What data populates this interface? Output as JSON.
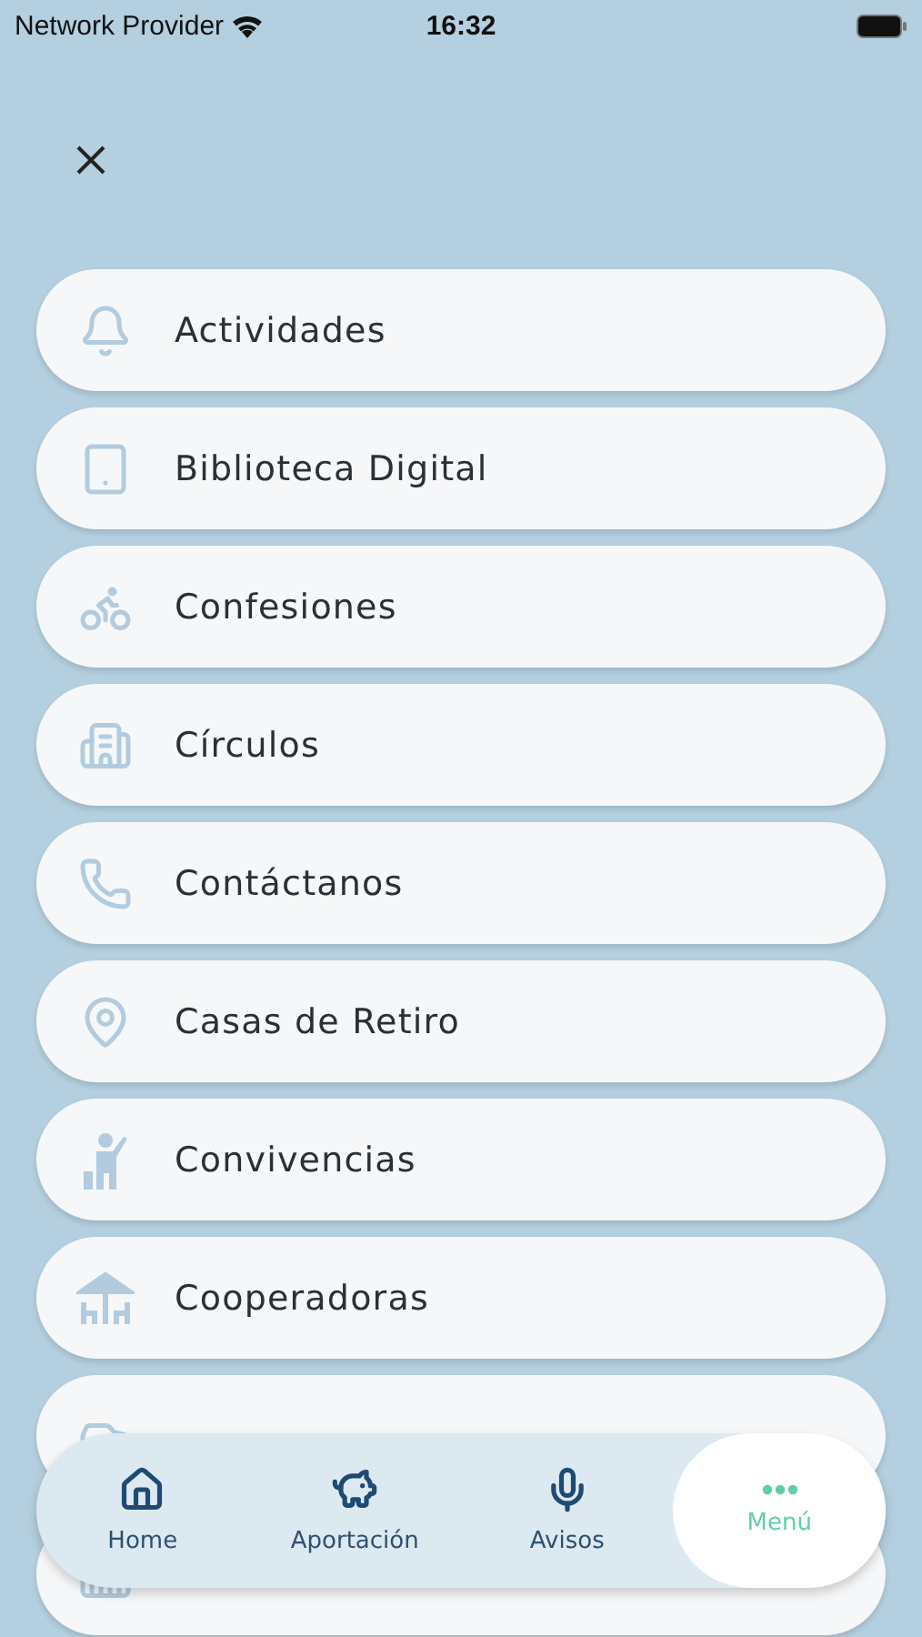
{
  "status_bar": {
    "carrier": "Network Provider",
    "time": "16:32"
  },
  "menu_items": [
    {
      "label": "Actividades"
    },
    {
      "label": "Biblioteca Digital"
    },
    {
      "label": "Confesiones"
    },
    {
      "label": "Círculos"
    },
    {
      "label": "Contáctanos"
    },
    {
      "label": "Casas de Retiro"
    },
    {
      "label": "Convivencias"
    },
    {
      "label": "Cooperadoras"
    }
  ],
  "tab_bar": [
    {
      "label": "Home",
      "selected": false
    },
    {
      "label": "Aportación",
      "selected": false
    },
    {
      "label": "Avisos",
      "selected": false
    },
    {
      "label": "Menú",
      "selected": true
    }
  ]
}
